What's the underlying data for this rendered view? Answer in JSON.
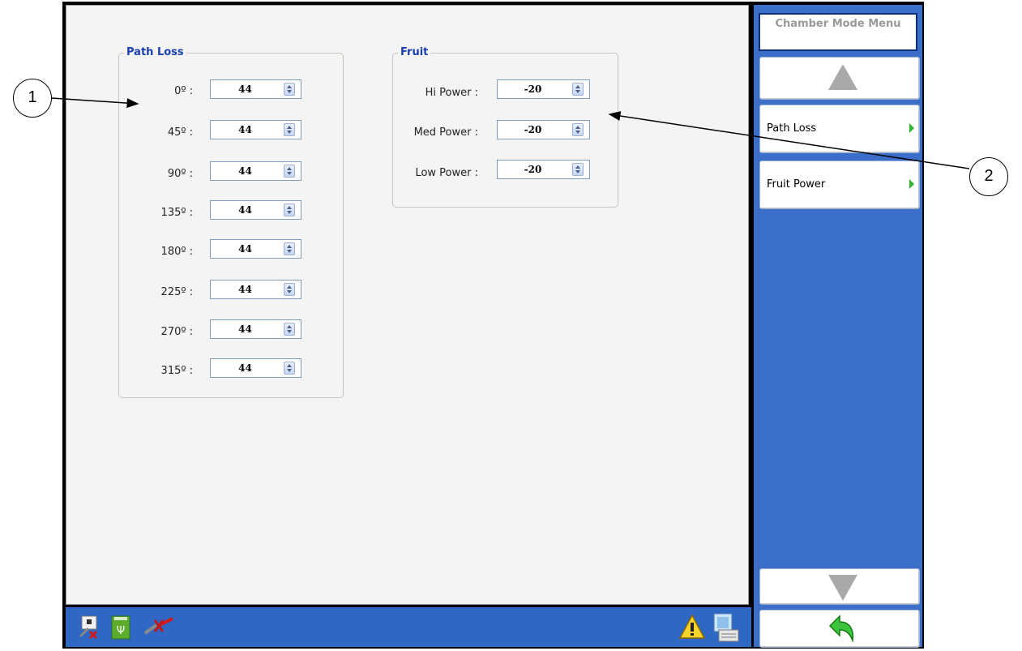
{
  "path_loss": {
    "title": "Path Loss",
    "rows": [
      {
        "label": "0º :",
        "value": "44"
      },
      {
        "label": "45º :",
        "value": "44"
      },
      {
        "label": "90º :",
        "value": "44"
      },
      {
        "label": "135º :",
        "value": "44"
      },
      {
        "label": "180º :",
        "value": "44"
      },
      {
        "label": "225º :",
        "value": "44"
      },
      {
        "label": "270º :",
        "value": "44"
      },
      {
        "label": "315º :",
        "value": "44"
      }
    ]
  },
  "fruit": {
    "title": "Fruit",
    "rows": [
      {
        "label": "Hi Power :",
        "value": "-20"
      },
      {
        "label": "Med Power :",
        "value": "-20"
      },
      {
        "label": "Low Power :",
        "value": "-20"
      }
    ]
  },
  "menu": {
    "title": "Chamber Mode Menu",
    "items": [
      {
        "label": "Path Loss"
      },
      {
        "label": "Fruit Power"
      }
    ]
  },
  "callouts": [
    "1",
    "2"
  ],
  "icons": {
    "menu_up": "triangle-up-icon",
    "menu_down": "triangle-down-icon",
    "back": "back-arrow-icon",
    "submenu": "green-arrow-right-icon",
    "status": [
      "network-disconnected-icon",
      "usb-icon",
      "cable-disconnected-icon",
      "warning-icon",
      "keyboard-icon"
    ]
  },
  "colors": {
    "panel_blue": "#3a6ec8",
    "statusbar_blue": "#2e68c4",
    "group_title": "#1a3fb0",
    "submenu_arrow": "#2fb52f",
    "nav_triangle": "#a9a9a9"
  }
}
